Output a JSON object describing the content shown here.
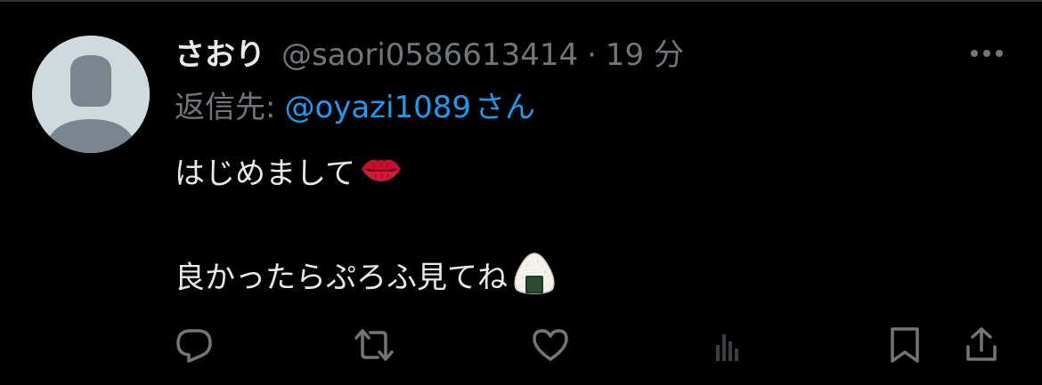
{
  "tweet": {
    "author": {
      "display_name": "さおり",
      "handle": "@saori0586613414",
      "avatar_icon": "default-profile-avatar"
    },
    "separator": "·",
    "time": "19 分",
    "reply_to": {
      "prefix": "返信先:",
      "handle": "@oyazi1089",
      "suffix": "さん"
    },
    "lines": [
      {
        "text": "はじめまして",
        "emoji": "kiss-lips-emoji"
      },
      {
        "text": "良かったらぷろふ見てね",
        "emoji": "rice-ball-emoji"
      }
    ],
    "more_icon": "more-dots-icon"
  },
  "actions": [
    {
      "name": "reply-button",
      "icon": "reply-icon"
    },
    {
      "name": "retweet-button",
      "icon": "retweet-icon"
    },
    {
      "name": "like-button",
      "icon": "heart-icon"
    },
    {
      "name": "views-button",
      "icon": "analytics-icon"
    },
    {
      "name": "bookmark-button",
      "icon": "bookmark-icon"
    },
    {
      "name": "share-button",
      "icon": "share-icon"
    }
  ],
  "colors": {
    "background": "#000000",
    "primary_text": "#e7e9ea",
    "secondary_text": "#71767b",
    "link": "#1d9bf0",
    "avatar_bg": "#cfd9de",
    "avatar_fg": "#7a8590"
  }
}
